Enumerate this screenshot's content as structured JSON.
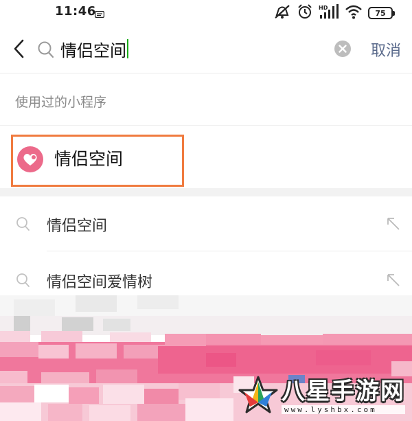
{
  "status_bar": {
    "time": "11:46",
    "battery": "75"
  },
  "search": {
    "query": "情侣空间",
    "cancel_label": "取消"
  },
  "recent_miniprograms": {
    "section_label": "使用过的小程序",
    "items": [
      {
        "name": "情侣空间",
        "icon": "heart-logo-icon",
        "highlighted": true
      }
    ]
  },
  "suggestions": [
    {
      "text": "情侣空间"
    },
    {
      "text": "情侣空间爱情树"
    }
  ],
  "watermark": {
    "title": "八星手游网",
    "url": "www.lyshbx.com"
  },
  "colors": {
    "highlight_border": "#f07b3f",
    "logo_pink": "#ec6a8a",
    "cancel_text": "#5b6b8c",
    "caret": "#1aad19",
    "blur_pink": "#f06b93"
  }
}
